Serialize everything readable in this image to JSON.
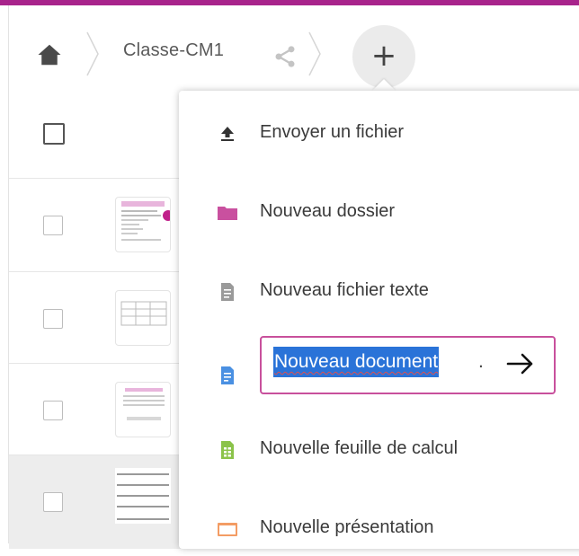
{
  "colors": {
    "accent": "#a8238b",
    "folder": "#c9509f",
    "rename_border": "#c8509c",
    "selection": "#2a73d8",
    "doc_blue": "#4a90e2",
    "sheet_green": "#8bc34a",
    "slides_orange": "#f39c64"
  },
  "breadcrumb": {
    "home_icon": "home-icon",
    "folder_label": "Classe-CM1",
    "share_icon": "share-icon",
    "add_button_symbol": "+"
  },
  "new_menu": {
    "items": [
      {
        "label": "Envoyer un fichier",
        "icon": "upload-icon"
      },
      {
        "label": "Nouveau dossier",
        "icon": "folder-icon"
      },
      {
        "label": "Nouveau fichier texte",
        "icon": "text-file-icon"
      },
      {
        "label": "Nouveau document",
        "icon": "document-icon",
        "editing": true
      },
      {
        "label": "Nouvelle feuille de calcul",
        "icon": "spreadsheet-icon"
      },
      {
        "label": "Nouvelle présentation",
        "icon": "presentation-icon"
      }
    ],
    "rename": {
      "value": "Nouveau document",
      "extension": ".",
      "submit_icon": "arrow-right-icon"
    }
  }
}
